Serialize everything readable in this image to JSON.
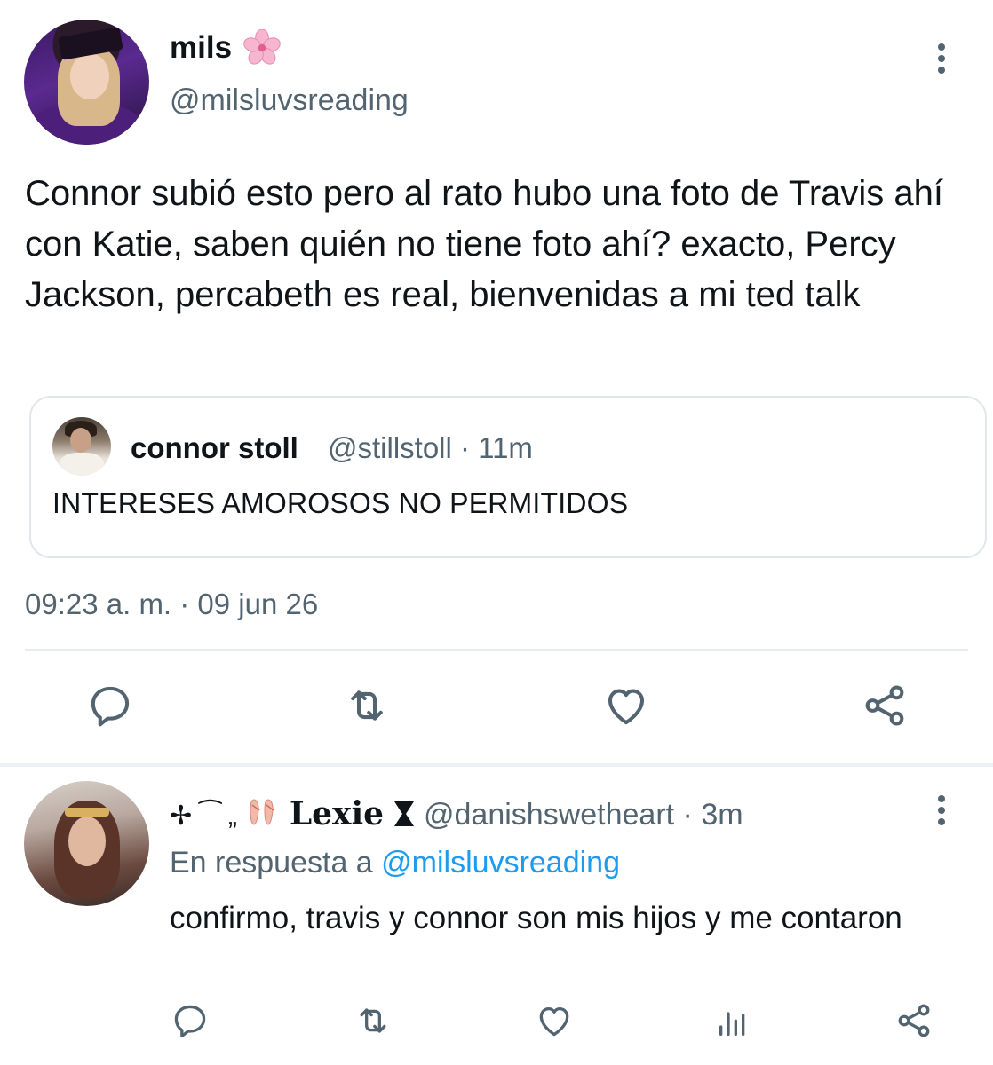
{
  "main_tweet": {
    "display_name": "mils",
    "name_emoji": "cherry-blossom",
    "handle": "@milsluvsreading",
    "text": "Connor subió esto pero al rato hubo una foto de Travis ahí con Katie, saben quién no tiene foto ahí? exacto, Percy Jackson, percabeth es real, bienvenidas a mi ted talk",
    "timestamp": "09:23 a. m. · 09 jun 26",
    "quote": {
      "display_name": "connor stoll",
      "meta": "@stillstoll · 11m",
      "text": "INTERESES AMOROSOS NO PERMITIDOS"
    },
    "actions": [
      "reply-icon",
      "retweet-icon",
      "like-icon",
      "share-icon"
    ]
  },
  "reply_tweet": {
    "prefix": "✢ ⁀ „",
    "display_name": "Lexie",
    "meta": "@danishswetheart · 3m",
    "reply_to_label": "En respuesta a",
    "reply_to_handle": "@milsluvsreading",
    "text": "confirmo, travis y connor son mis hijos y me contaron",
    "actions": [
      "reply-icon",
      "retweet-icon",
      "like-icon",
      "analytics-icon",
      "share-icon"
    ]
  },
  "colors": {
    "text_primary": "#0f1419",
    "text_secondary": "#536471",
    "link": "#1d9bf0",
    "border": "#e1e8ed"
  }
}
